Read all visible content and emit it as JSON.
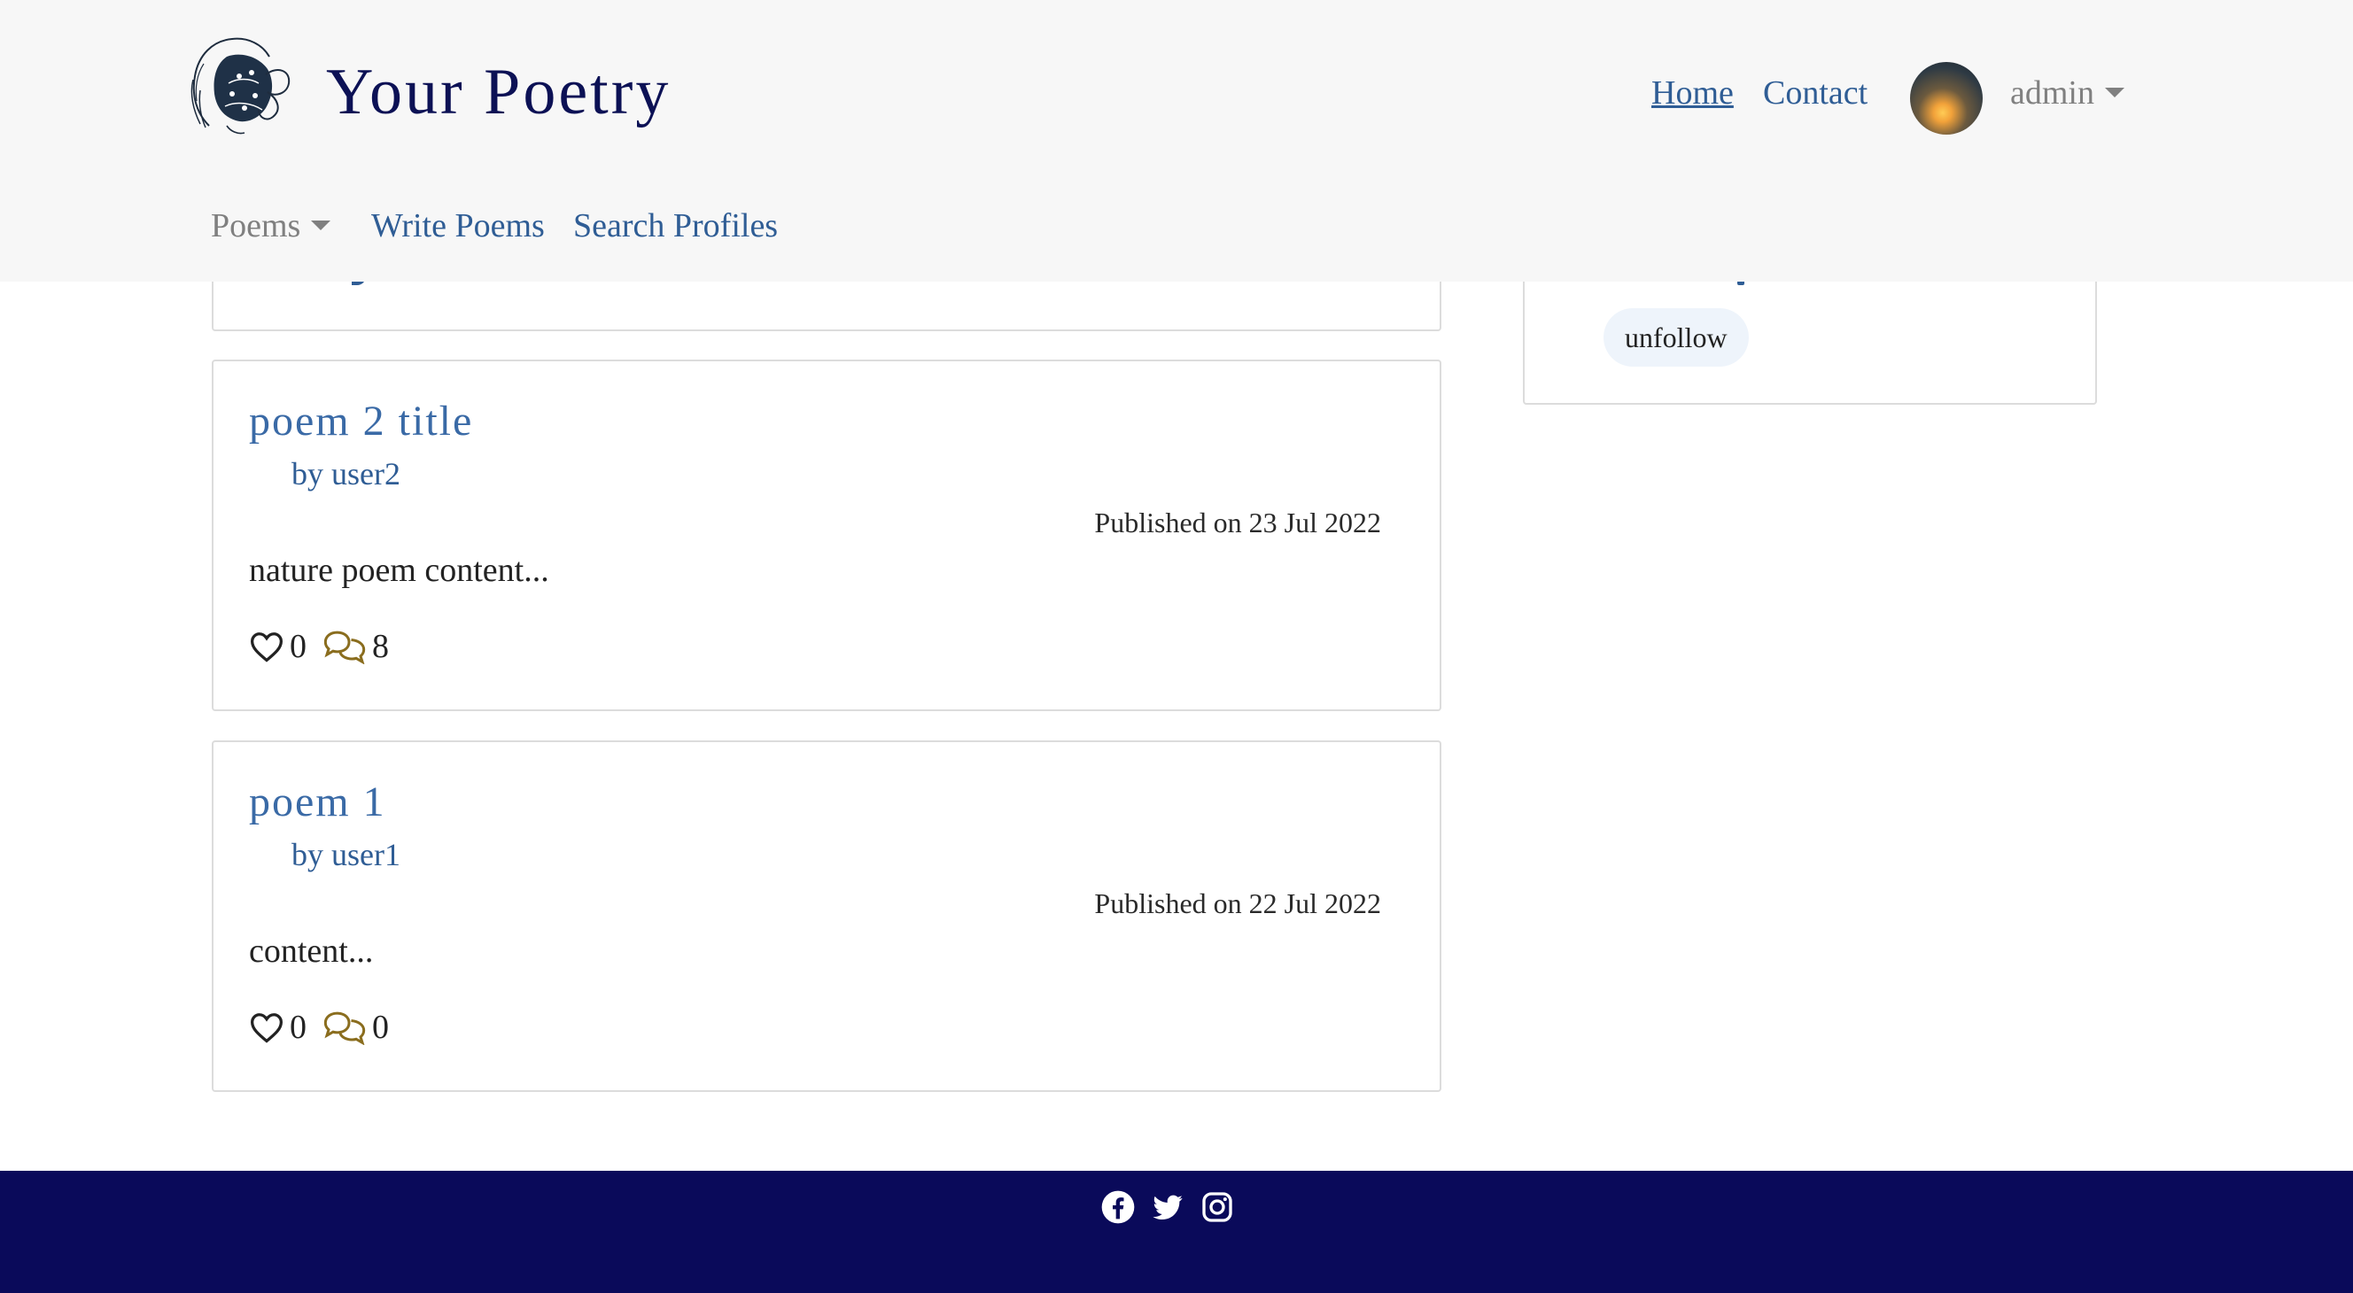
{
  "header": {
    "brand": "Your Poetry",
    "nav_top": {
      "home": "Home",
      "contact": "Contact",
      "user": "admin"
    },
    "nav_bottom": {
      "poems": "Poems",
      "write": "Write Poems",
      "search": "Search Profiles"
    }
  },
  "poems": [
    {
      "title": "poem 2 title",
      "author": "by user2",
      "date": "Published on 23 Jul 2022",
      "excerpt": "nature poem content...",
      "likes": "0",
      "comments": "8"
    },
    {
      "title": "poem 1",
      "author": "by user1",
      "date": "Published on 22 Jul 2022",
      "excerpt": "content...",
      "likes": "0",
      "comments": "0"
    }
  ],
  "sidebar": {
    "unfollow_label": "unfollow"
  },
  "icons": {
    "like": "heart-icon",
    "comment": "comments-icon",
    "footer": [
      "facebook-icon",
      "twitter-icon",
      "instagram-icon"
    ]
  },
  "colors": {
    "header_bg": "#f7f7f7",
    "brand": "#0c1155",
    "link": "#2f5d95",
    "comment_icon": "#8a6d1e",
    "footer_bg": "#0a0a5a"
  }
}
